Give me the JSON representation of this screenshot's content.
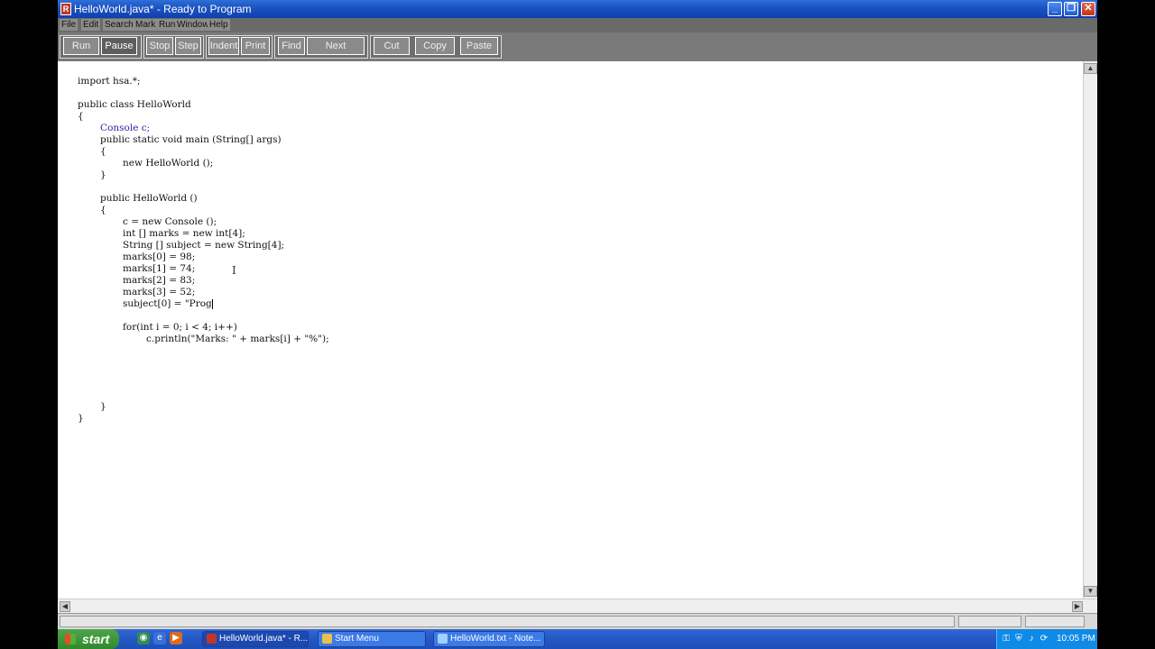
{
  "window": {
    "title": "HelloWorld.java* - Ready to Program",
    "controls": {
      "minimize": "_",
      "maximize": "❐",
      "close": "✕"
    }
  },
  "menu": [
    {
      "label": "File"
    },
    {
      "label": "Edit"
    },
    {
      "label": "Search"
    },
    {
      "label": "Mark"
    },
    {
      "label": "Run"
    },
    {
      "label": "Window"
    },
    {
      "label": "Help"
    }
  ],
  "toolbar": {
    "buttons": [
      {
        "label": "Run"
      },
      {
        "label": "Pause"
      },
      {
        "label": "Stop"
      },
      {
        "label": "Step"
      },
      {
        "label": "Indent"
      },
      {
        "label": "Print"
      },
      {
        "label": "Find"
      },
      {
        "label": "Next"
      },
      {
        "label": "Cut"
      },
      {
        "label": "Copy"
      },
      {
        "label": "Paste"
      }
    ]
  },
  "editor": {
    "lines": [
      {
        "text": "import hsa.*;",
        "indent": 0
      },
      {
        "text": "",
        "indent": 0
      },
      {
        "text": "public class HelloWorld",
        "indent": 0
      },
      {
        "text": "{",
        "indent": 0
      },
      {
        "text": "Console c;",
        "indent": 1
      },
      {
        "text": "public static void main (String[] args)",
        "indent": 1
      },
      {
        "text": "{",
        "indent": 1
      },
      {
        "text": "new HelloWorld ();",
        "indent": 2
      },
      {
        "text": "}",
        "indent": 1
      },
      {
        "text": "",
        "indent": 0
      },
      {
        "text": "public HelloWorld ()",
        "indent": 1
      },
      {
        "text": "{",
        "indent": 1
      },
      {
        "text": "c = new Console ();",
        "indent": 2
      },
      {
        "text": "int [] marks = new int[4];",
        "indent": 2
      },
      {
        "text": "String [] subject = new String[4];",
        "indent": 2
      },
      {
        "text": "marks[0] = 98;",
        "indent": 2
      },
      {
        "text": "marks[1] = 74;",
        "indent": 2
      },
      {
        "text": "marks[2] = 83;",
        "indent": 2
      },
      {
        "text": "marks[3] = 52;",
        "indent": 2
      },
      {
        "text": "subject[0] = \"Prog",
        "indent": 2
      },
      {
        "text": "",
        "indent": 0
      },
      {
        "text": "for(int i = 0; i < 4; i++)",
        "indent": 2
      },
      {
        "text": "c.println(\"Marks: \" + marks[i] + \"%\");",
        "indent": 3
      },
      {
        "text": "",
        "indent": 0
      },
      {
        "text": "",
        "indent": 0
      },
      {
        "text": "",
        "indent": 0
      },
      {
        "text": "",
        "indent": 0
      },
      {
        "text": "",
        "indent": 0
      },
      {
        "text": "}",
        "indent": 1
      },
      {
        "text": "}",
        "indent": 0
      }
    ]
  },
  "taskbar": {
    "start_label": "start",
    "tasks": [
      {
        "label": "HelloWorld.java* - R...",
        "icon_color": "#c2352a"
      },
      {
        "label": "Start Menu",
        "icon_color": "#e8c14a"
      },
      {
        "label": "HelloWorld.txt - Note...",
        "icon_color": "#9fd0ff"
      }
    ],
    "clock": "10:05 PM"
  }
}
